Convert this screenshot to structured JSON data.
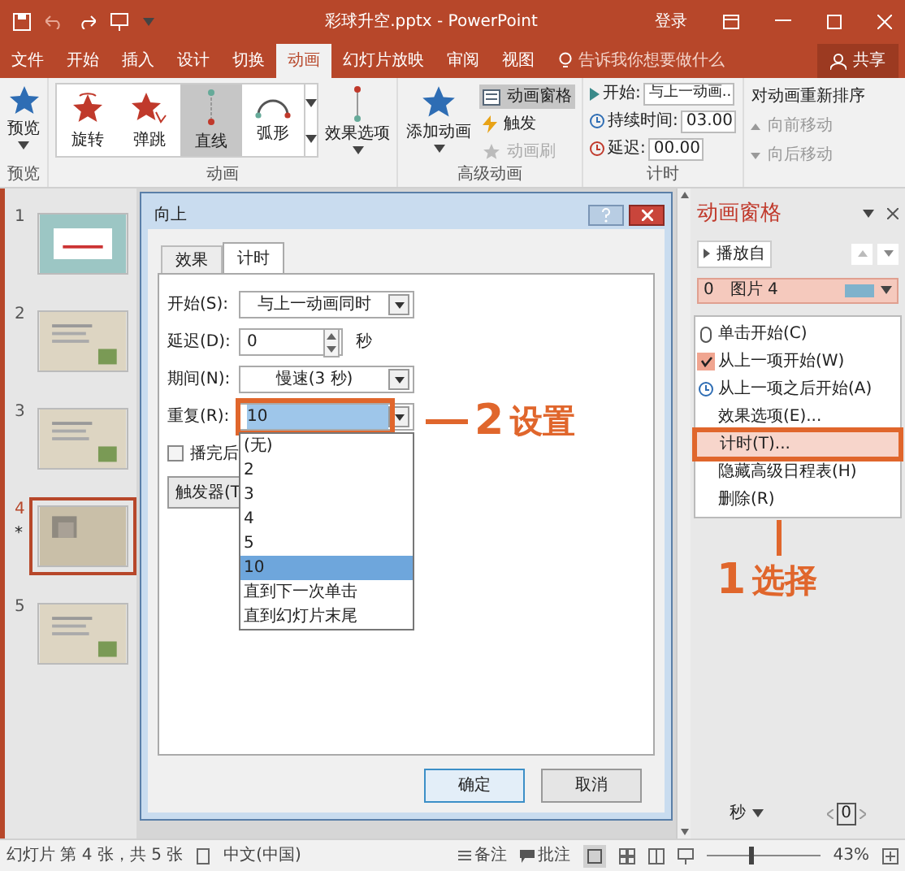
{
  "window": {
    "title": "彩球升空.pptx - PowerPoint",
    "sign_in": "登录"
  },
  "ribbon_tabs": [
    {
      "label": "文件",
      "selected": false
    },
    {
      "label": "开始",
      "selected": false
    },
    {
      "label": "插入",
      "selected": false
    },
    {
      "label": "设计",
      "selected": false
    },
    {
      "label": "切换",
      "selected": false
    },
    {
      "label": "动画",
      "selected": true
    },
    {
      "label": "幻灯片放映",
      "selected": false
    },
    {
      "label": "审阅",
      "selected": false
    },
    {
      "label": "视图",
      "selected": false
    }
  ],
  "tell_me": {
    "placeholder": "告诉我你想要做什么"
  },
  "share_button": "共享",
  "ribbon": {
    "preview": {
      "label": "预览",
      "group": "预览"
    },
    "animation_group": {
      "label": "动画",
      "effect_options": "效果选项",
      "gallery": [
        {
          "label": "旋转",
          "kind": "spin",
          "selected": false
        },
        {
          "label": "弹跳",
          "kind": "bounce",
          "selected": false
        },
        {
          "label": "直线",
          "kind": "line",
          "selected": true
        },
        {
          "label": "弧形",
          "kind": "arc",
          "selected": false
        }
      ]
    },
    "advanced_group": {
      "label": "高级动画",
      "add_animation": "添加动画",
      "items": [
        {
          "label": "动画窗格",
          "kind": "pane",
          "selected": true,
          "disabled": false
        },
        {
          "label": "触发",
          "kind": "trigger",
          "selected": false,
          "disabled": false
        },
        {
          "label": "动画刷",
          "kind": "painter",
          "selected": false,
          "disabled": true
        }
      ]
    },
    "timing_group": {
      "label": "计时",
      "start_label": "开始:",
      "start_value": "与上一动画...",
      "duration_label": "持续时间:",
      "duration_value": "03.00",
      "delay_label": "延迟:",
      "delay_value": "00.00"
    },
    "reorder": {
      "title": "对动画重新排序",
      "move_earlier": "向前移动",
      "move_later": "向后移动"
    }
  },
  "slides": [
    {
      "number": "1",
      "selected": false,
      "kind": "cover"
    },
    {
      "number": "2",
      "selected": false,
      "kind": "text"
    },
    {
      "number": "3",
      "selected": false,
      "kind": "text"
    },
    {
      "number": "4",
      "selected": true,
      "kind": "pattern",
      "animation_mark": "*"
    },
    {
      "number": "5",
      "selected": false,
      "kind": "text"
    }
  ],
  "dialog": {
    "title": "向上",
    "tabs": [
      {
        "label": "效果",
        "selected": false
      },
      {
        "label": "计时",
        "selected": true
      }
    ],
    "fields": [
      {
        "label": "开始(S):",
        "value": "与上一动画同时",
        "kind": "dropdown"
      },
      {
        "label": "延迟(D):",
        "value": "0",
        "kind": "spinner",
        "unit": "秒"
      },
      {
        "label": "期间(N):",
        "value": "慢速(3 秒)",
        "kind": "dropdown"
      },
      {
        "label": "重复(R):",
        "value": "10",
        "kind": "combo"
      }
    ],
    "repeat_options": [
      {
        "label": "(无)",
        "selected": false
      },
      {
        "label": "2",
        "selected": false
      },
      {
        "label": "3",
        "selected": false
      },
      {
        "label": "4",
        "selected": false
      },
      {
        "label": "5",
        "selected": false
      },
      {
        "label": "10",
        "selected": true
      },
      {
        "label": "直到下一次单击",
        "selected": false
      },
      {
        "label": "直到幻灯片末尾",
        "selected": false
      }
    ],
    "checkbox": {
      "label": "播完后",
      "checked": false
    },
    "trigger_button": "触发器(T",
    "buttons": [
      {
        "label": "确定",
        "default": true
      },
      {
        "label": "取消",
        "default": false
      }
    ]
  },
  "animation_pane": {
    "title": "动画窗格",
    "play_from": "播放自",
    "items": [
      {
        "number": "0",
        "name": "图片 4",
        "selected": true
      }
    ],
    "context_menu": [
      {
        "label": "单击开始(C)",
        "kind": "mouse",
        "checked": false,
        "selected": false
      },
      {
        "label": "从上一项开始(W)",
        "kind": "check",
        "checked": true,
        "selected": false
      },
      {
        "label": "从上一项之后开始(A)",
        "kind": "clock",
        "checked": false,
        "selected": false
      },
      {
        "label": "效果选项(E)...",
        "kind": "plain",
        "checked": false,
        "selected": false
      },
      {
        "label": "计时(T)...",
        "kind": "plain",
        "checked": false,
        "selected": true
      },
      {
        "label": "隐藏高级日程表(H)",
        "kind": "plain",
        "checked": false,
        "selected": false
      },
      {
        "label": "删除(R)",
        "kind": "plain",
        "checked": false,
        "selected": false
      }
    ],
    "seconds": "秒",
    "timeline_value": "0"
  },
  "annotations": [
    {
      "number": "2",
      "label": "设置"
    },
    {
      "number": "1",
      "label": "选择"
    }
  ],
  "status_bar": {
    "slide_info": "幻灯片 第 4 张，共 5 张",
    "language": "中文(中国)",
    "notes": "备注",
    "comments": "批注",
    "zoom": "43%",
    "level": 0.4
  }
}
